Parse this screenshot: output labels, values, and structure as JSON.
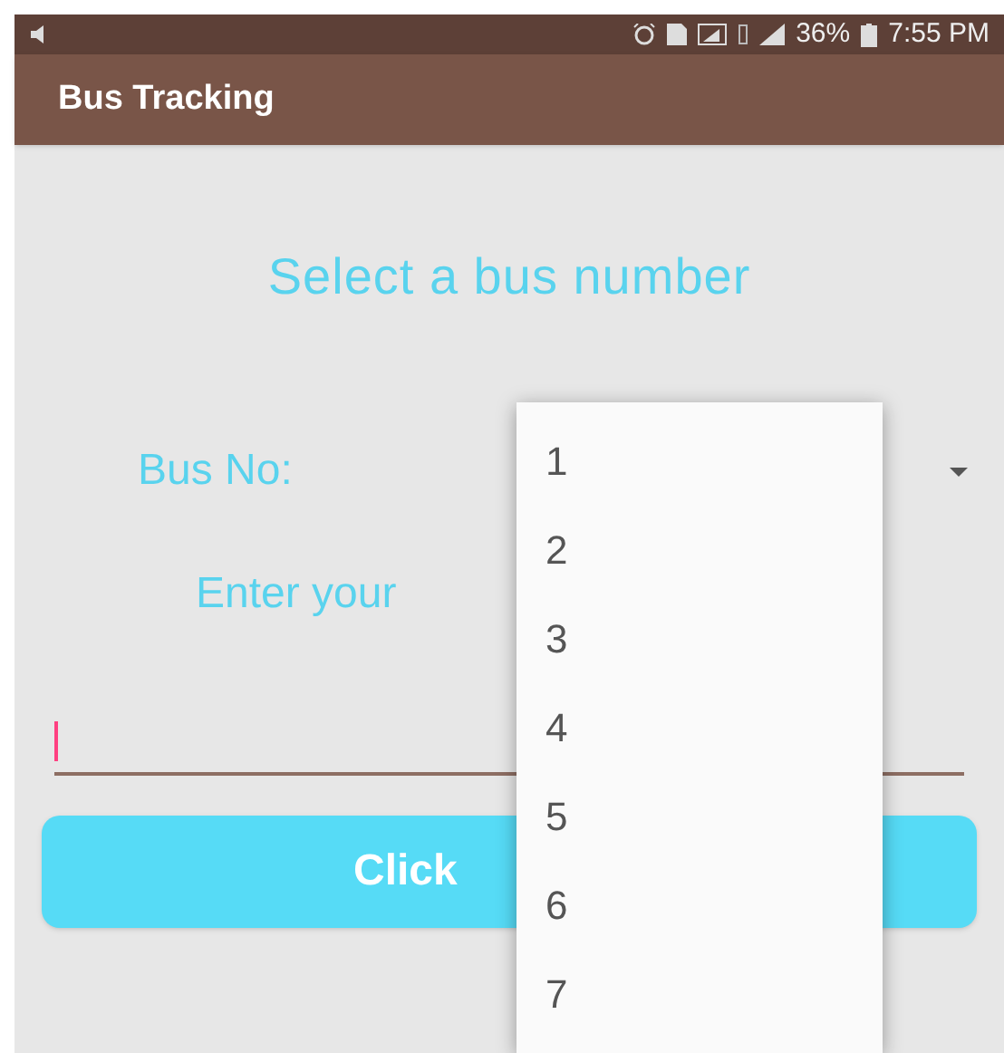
{
  "status_bar": {
    "battery": "36%",
    "time": "7:55 PM"
  },
  "app_bar": {
    "title": "Bus Tracking"
  },
  "heading": "Select a bus number",
  "bus_label": "Bus No:",
  "prompt": "Enter your",
  "input": {
    "focused": true
  },
  "button": {
    "label": "Click"
  },
  "dropdown": {
    "options": [
      {
        "label": "1"
      },
      {
        "label": "2"
      },
      {
        "label": "3"
      },
      {
        "label": "4"
      },
      {
        "label": "5"
      },
      {
        "label": "6"
      },
      {
        "label": "7"
      }
    ]
  }
}
